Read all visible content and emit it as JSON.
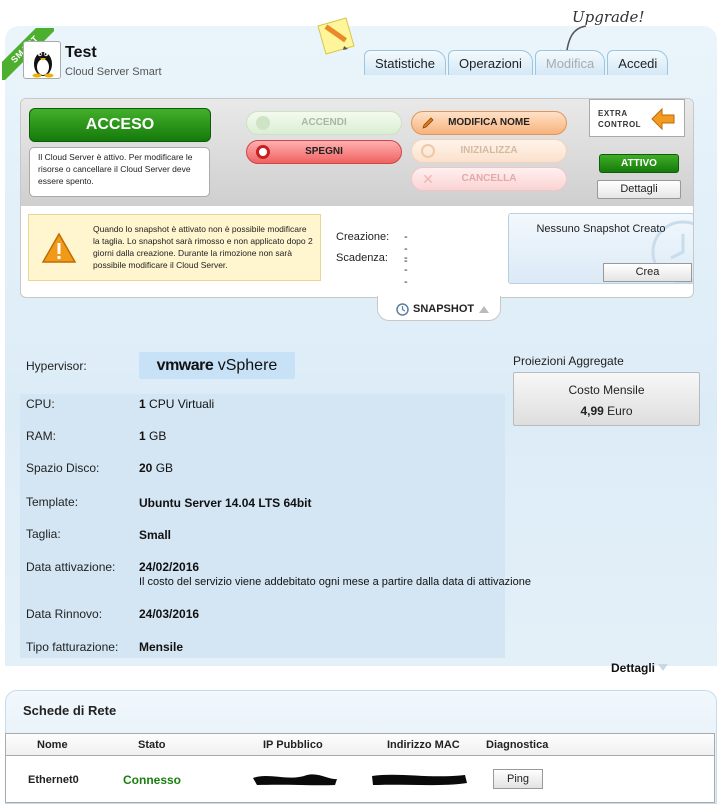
{
  "server": {
    "ribbon": "SMART",
    "name": "Test",
    "type": "Cloud Server Smart"
  },
  "annotation": {
    "upgrade": "Upgrade!"
  },
  "tabs": [
    {
      "label": "Statistiche",
      "enabled": true
    },
    {
      "label": "Operazioni",
      "enabled": true
    },
    {
      "label": "Modifica",
      "enabled": false
    },
    {
      "label": "Accedi",
      "enabled": true
    }
  ],
  "controls": {
    "status_button": "ACCESO",
    "status_note": "Il Cloud Server è attivo. Per modificare le risorse o cancellare il Cloud Server deve essere spento.",
    "accendi": "ACCENDI",
    "spegni": "SPEGNI",
    "modifica_nome": "MODIFICA NOME",
    "inizializza": "INIZIALIZZA",
    "cancella": "CANCELLA",
    "extra_control": {
      "line1": "EXTRA",
      "line2": "CONTROL",
      "state": "ATTIVO",
      "details": "Dettagli"
    }
  },
  "snapshot": {
    "warning": "Quando lo snapshot è attivato non è possibile modificare la taglia. Lo snapshot sarà rimosso e non applicato dopo 2 giorni dalla creazione. Durante la rimozione non sarà possibile modificare il Cloud Server.",
    "creazione_label": "Creazione:",
    "creazione_value": "---",
    "scadenza_label": "Scadenza:",
    "scadenza_value": "---",
    "status": "Nessuno Snapshot Creato",
    "create_button": "Crea",
    "tab_label": "SNAPSHOT"
  },
  "details": {
    "hypervisor_label": "Hypervisor:",
    "hypervisor_logo": {
      "brand": "vmware",
      "product": " vSphere"
    },
    "cpu_label": "CPU:",
    "cpu_count": "1",
    "cpu_unit": " CPU Virtuali",
    "ram_label": "RAM:",
    "ram_value": "1",
    "ram_unit": " GB",
    "disk_label": "Spazio Disco:",
    "disk_value": "20",
    "disk_unit": " GB",
    "template_label": "Template:",
    "template_value": "Ubuntu Server 14.04 LTS 64bit",
    "size_label": "Taglia:",
    "size_value": "Small",
    "activation_label": "Data attivazione:",
    "activation_value": "24/02/2016",
    "activation_note": "Il costo del servizio viene addebitato ogni mese a partire dalla data di attivazione",
    "renewal_label": "Data Rinnovo:",
    "renewal_value": "24/03/2016",
    "billing_label": "Tipo fatturazione:",
    "billing_value": "Mensile",
    "more_link": "Dettagli"
  },
  "projections": {
    "title": "Proiezioni Aggregate",
    "cost_label": "Costo Mensile",
    "cost_value": "4,99",
    "cost_unit": " Euro"
  },
  "network": {
    "title": "Schede di Rete",
    "columns": [
      "Nome",
      "Stato",
      "IP Pubblico",
      "Indirizzo MAC",
      "Diagnostica"
    ],
    "rows": [
      {
        "name": "Ethernet0",
        "status": "Connesso",
        "action": "Ping"
      }
    ]
  },
  "colors": {
    "green": "#1a7f0f",
    "red": "#f06262",
    "orange": "#f7b37c",
    "panel_blue": "#dcecf7"
  }
}
